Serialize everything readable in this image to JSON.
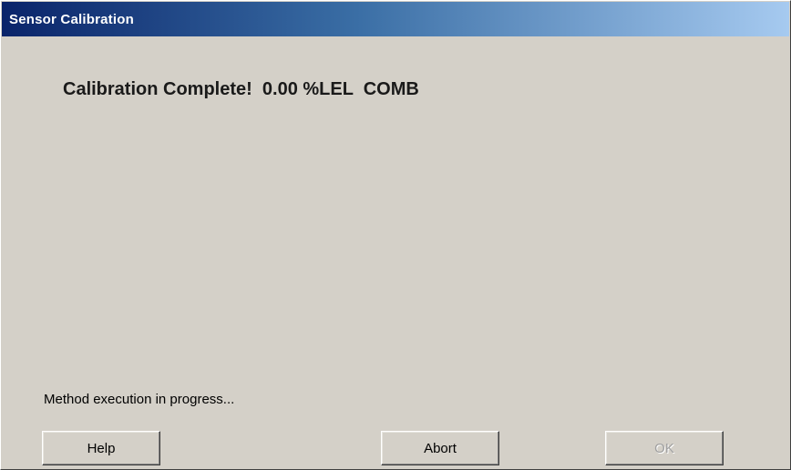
{
  "window": {
    "title": "Sensor Calibration"
  },
  "main": {
    "status_message": "Calibration Complete!  0.00 %LEL  COMB",
    "progress_message": "Method execution in progress..."
  },
  "buttons": {
    "help_label": "Help",
    "abort_label": "Abort",
    "ok_label": "OK",
    "ok_enabled": false
  },
  "colors": {
    "titlebar_start": "#0a246a",
    "titlebar_end": "#a6caf0",
    "dialog_background": "#d4d0c8"
  }
}
